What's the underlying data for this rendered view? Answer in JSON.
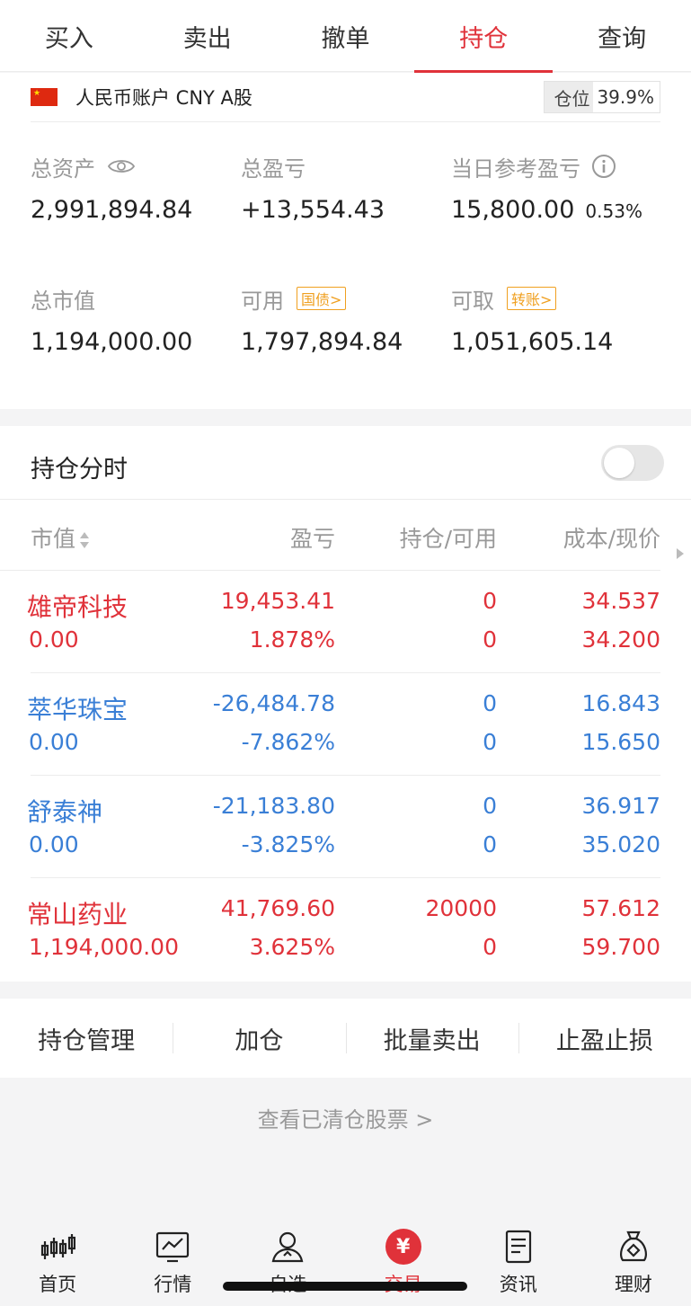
{
  "tabs": [
    {
      "label": "买入"
    },
    {
      "label": "卖出"
    },
    {
      "label": "撤单"
    },
    {
      "label": "持仓"
    },
    {
      "label": "查询"
    }
  ],
  "account": {
    "name": "人民币账户 CNY A股",
    "position_label": "仓位",
    "position_value": "39.9%"
  },
  "summary": {
    "total_assets": {
      "label": "总资产",
      "value": "2,991,894.84"
    },
    "total_pl": {
      "label": "总盈亏",
      "value": "+13,554.43"
    },
    "daily_pl": {
      "label": "当日参考盈亏",
      "value": "15,800.00",
      "pct": "0.53%"
    },
    "market_value": {
      "label": "总市值",
      "value": "1,194,000.00"
    },
    "available": {
      "label": "可用",
      "tag": "国债>",
      "value": "1,797,894.84"
    },
    "withdrawable": {
      "label": "可取",
      "tag": "转账>",
      "value": "1,051,605.14"
    }
  },
  "holdings_timeline": {
    "label": "持仓分时",
    "enabled": false
  },
  "columns": {
    "market_value": "市值",
    "pl": "盈亏",
    "qty": "持仓/可用",
    "price": "成本/现价"
  },
  "holdings": [
    {
      "name": "雄帝科技",
      "market_value": "0.00",
      "pl": "19,453.41",
      "pl_pct": "1.878%",
      "qty": "0",
      "available": "0",
      "cost": "34.537",
      "price": "34.200",
      "color": "red"
    },
    {
      "name": "萃华珠宝",
      "market_value": "0.00",
      "pl": "-26,484.78",
      "pl_pct": "-7.862%",
      "qty": "0",
      "available": "0",
      "cost": "16.843",
      "price": "15.650",
      "color": "blue"
    },
    {
      "name": "舒泰神",
      "market_value": "0.00",
      "pl": "-21,183.80",
      "pl_pct": "-3.825%",
      "qty": "0",
      "available": "0",
      "cost": "36.917",
      "price": "35.020",
      "color": "blue"
    },
    {
      "name": "常山药业",
      "market_value": "1,194,000.00",
      "pl": "41,769.60",
      "pl_pct": "3.625%",
      "qty": "20000",
      "available": "0",
      "cost": "57.612",
      "price": "59.700",
      "color": "red"
    }
  ],
  "actions": [
    {
      "label": "持仓管理"
    },
    {
      "label": "加仓"
    },
    {
      "label": "批量卖出"
    },
    {
      "label": "止盈止损"
    }
  ],
  "cleared_link": "查看已清仓股票 >",
  "nav": [
    {
      "label": "首页",
      "icon": "candlestick-icon"
    },
    {
      "label": "行情",
      "icon": "chart-monitor-icon"
    },
    {
      "label": "自选",
      "icon": "user-star-icon"
    },
    {
      "label": "交易",
      "icon": "yuan-icon",
      "glyph": "¥"
    },
    {
      "label": "资讯",
      "icon": "document-icon"
    },
    {
      "label": "理财",
      "icon": "money-bag-icon"
    }
  ],
  "colors": {
    "up": "#e0323a",
    "down": "#3a7fd6",
    "tag": "#f0a020"
  }
}
